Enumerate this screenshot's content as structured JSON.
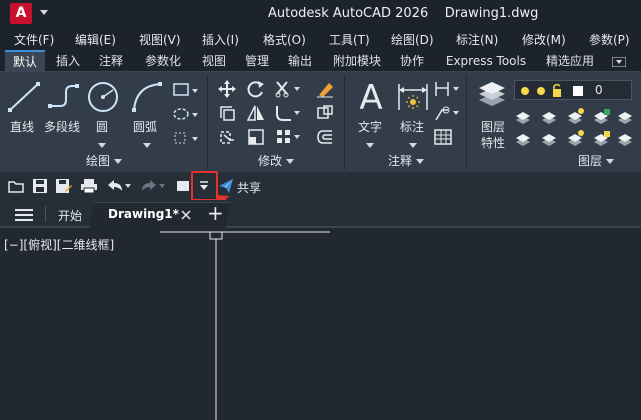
{
  "titlebar": {
    "app_letter": "A",
    "title": "Autodesk AutoCAD 2026    Drawing1.dwg"
  },
  "menu": [
    "文件(F)",
    "编辑(E)",
    "视图(V)",
    "插入(I)",
    "格式(O)",
    "工具(T)",
    "绘图(D)",
    "标注(N)",
    "修改(M)",
    "参数(P)"
  ],
  "ribbon_tabs": [
    "默认",
    "插入",
    "注释",
    "参数化",
    "视图",
    "管理",
    "输出",
    "附加模块",
    "协作",
    "Express Tools",
    "精选应用"
  ],
  "ribbon": {
    "draw": {
      "line": "直线",
      "polyline": "多段线",
      "circle": "圆",
      "arc": "圆弧",
      "panel_title": "绘图"
    },
    "modify": {
      "panel_title": "修改"
    },
    "annotation": {
      "text": "文字",
      "dimension": "标注",
      "panel_title": "注释"
    },
    "layers": {
      "layer_properties_line1": "图层",
      "layer_properties_line2": "特性",
      "current_layer": "0",
      "panel_title": "图层"
    }
  },
  "quick_access": {
    "share": "共享"
  },
  "doc_tabs": {
    "start": "开始",
    "active": "Drawing1*",
    "new_tab": "+"
  },
  "viewport_label": "[−][俯视][二维线框]",
  "colors": {
    "accent": "#3d8fd8",
    "highlight": "#e4332c",
    "app_red": "#c8102e",
    "background": "#212830"
  }
}
